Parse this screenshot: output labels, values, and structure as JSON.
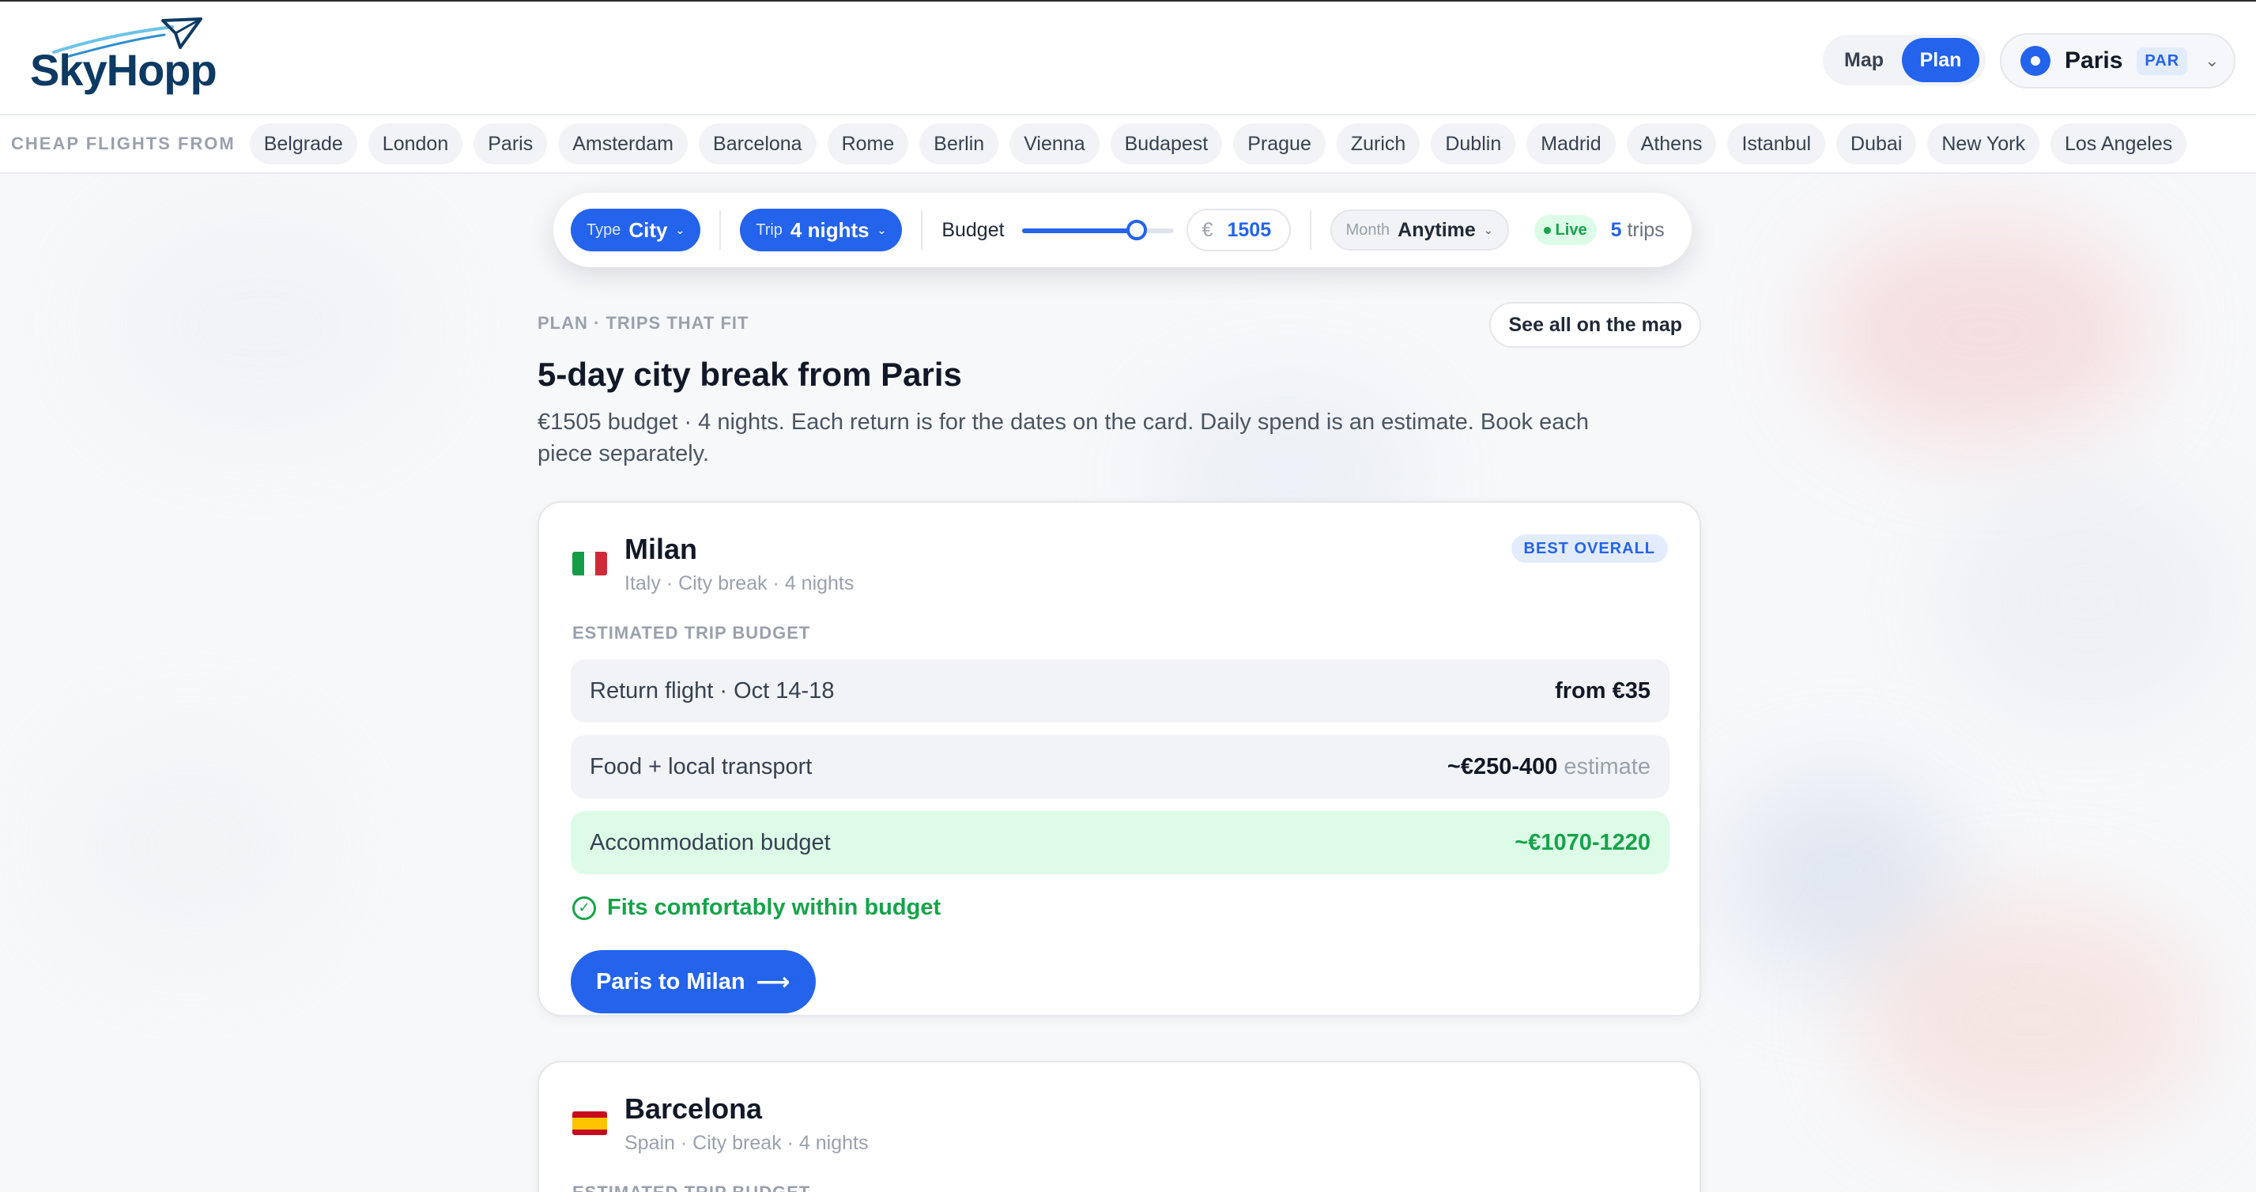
{
  "brand": {
    "name": "SkyHopp",
    "logo_icon": "paper-plane-icon",
    "color": "#0c3a63"
  },
  "view_toggle": {
    "map": "Map",
    "plan": "Plan",
    "active": "plan"
  },
  "origin": {
    "city": "Paris",
    "code": "PAR",
    "icon": "location-pin-icon"
  },
  "cheap_flights": {
    "label": "CHEAP FLIGHTS FROM",
    "cities": [
      "Belgrade",
      "London",
      "Paris",
      "Amsterdam",
      "Barcelona",
      "Rome",
      "Berlin",
      "Vienna",
      "Budapest",
      "Prague",
      "Zurich",
      "Dublin",
      "Madrid",
      "Athens",
      "Istanbul",
      "Dubai",
      "New York",
      "Los Angeles"
    ]
  },
  "filters": {
    "type": {
      "key": "Type",
      "value": "City"
    },
    "trip": {
      "key": "Trip",
      "value": "4 nights"
    },
    "budget": {
      "label": "Budget",
      "currency": "€",
      "value": "1505",
      "slider_fraction": 0.76
    },
    "month": {
      "key": "Month",
      "value": "Anytime"
    },
    "live": "Live",
    "trip_count": "5",
    "trip_count_suffix": "trips"
  },
  "plan": {
    "eyebrow": "PLAN · TRIPS THAT FIT",
    "see_all": "See all on the map",
    "title": "5-day city break from Paris",
    "subtitle": "€1505 budget · 4 nights. Each return is for the dates on the card. Daily spend is an estimate. Book each piece separately."
  },
  "cards": [
    {
      "city": "Milan",
      "meta": "Italy · City break · 4 nights",
      "badge": "BEST OVERALL",
      "section_label": "ESTIMATED TRIP BUDGET",
      "rows": [
        {
          "label": "Return flight · Oct 14-18",
          "value": "from €35",
          "note": ""
        },
        {
          "label": "Food + local transport",
          "value": "~€250-400",
          "note": "estimate"
        },
        {
          "label": "Accommodation budget",
          "value": "~€1070-1220",
          "note": ""
        }
      ],
      "fit_text": "Fits comfortably within budget",
      "cta": "Paris to Milan",
      "cta_arrow": "⟶"
    },
    {
      "city": "Barcelona",
      "meta": "Spain · City break · 4 nights",
      "section_label": "ESTIMATED TRIP BUDGET"
    }
  ],
  "colors": {
    "accent": "#2463eb",
    "success": "#16a34a",
    "success_bg": "#dcfce7"
  }
}
